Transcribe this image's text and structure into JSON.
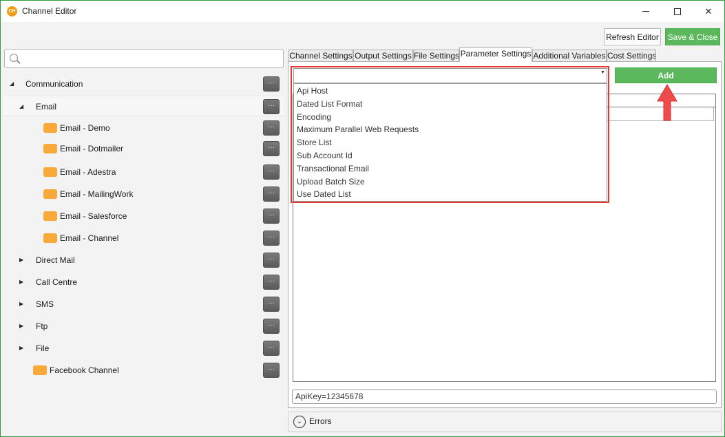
{
  "window": {
    "title": "Channel Editor",
    "app_icon_text": "CH"
  },
  "toolbar": {
    "refresh_label": "Refresh Editor",
    "save_label": "Save & Close"
  },
  "search": {
    "placeholder": ""
  },
  "tree": {
    "more_label": "···",
    "items": [
      {
        "label": "Communication",
        "level": 0,
        "expander": "expanded"
      },
      {
        "label": "Email",
        "level": 1,
        "expander": "expanded",
        "selected": true
      },
      {
        "label": "Email - Demo",
        "level": 2,
        "icon": "folder-icon"
      },
      {
        "label": "Email - Dotmailer",
        "level": 2,
        "icon": "folder-icon"
      },
      {
        "label": "Email - Adestra",
        "level": 2,
        "icon": "folder-icon"
      },
      {
        "label": "Email - MailingWork",
        "level": 2,
        "icon": "folder-icon"
      },
      {
        "label": "Email - Salesforce",
        "level": 2,
        "icon": "folder-icon"
      },
      {
        "label": "Email - Channel",
        "level": 2,
        "icon": "folder-icon"
      },
      {
        "label": "Direct Mail",
        "level": 1,
        "expander": "collapsed"
      },
      {
        "label": "Call Centre",
        "level": 1,
        "expander": "collapsed"
      },
      {
        "label": "SMS",
        "level": 1,
        "expander": "collapsed"
      },
      {
        "label": "Ftp",
        "level": 1,
        "expander": "collapsed"
      },
      {
        "label": "File",
        "level": 1,
        "expander": "collapsed"
      },
      {
        "label": "Facebook Channel",
        "level": 1,
        "icon": "folder-icon"
      }
    ]
  },
  "tabs": [
    {
      "label": "Channel Settings"
    },
    {
      "label": "Output Settings"
    },
    {
      "label": "File Settings"
    },
    {
      "label": "Parameter Settings",
      "active": true
    },
    {
      "label": "Additional Variables"
    },
    {
      "label": "Cost Settings"
    }
  ],
  "parameter_settings": {
    "combo_value": "",
    "add_label": "Add",
    "dropdown_options": [
      "Api Host",
      "Dated List Format",
      "Encoding",
      "Maximum Parallel Web Requests",
      "Store List",
      "Sub Account Id",
      "Transactional Email",
      "Upload Batch Size",
      "Use Dated List"
    ],
    "value_text": "ApiKey=12345678"
  },
  "errors": {
    "label": "Errors"
  },
  "colors": {
    "accent_green": "#5cb85c",
    "highlight_red": "#e53935",
    "folder_orange": "#f7a93a"
  }
}
